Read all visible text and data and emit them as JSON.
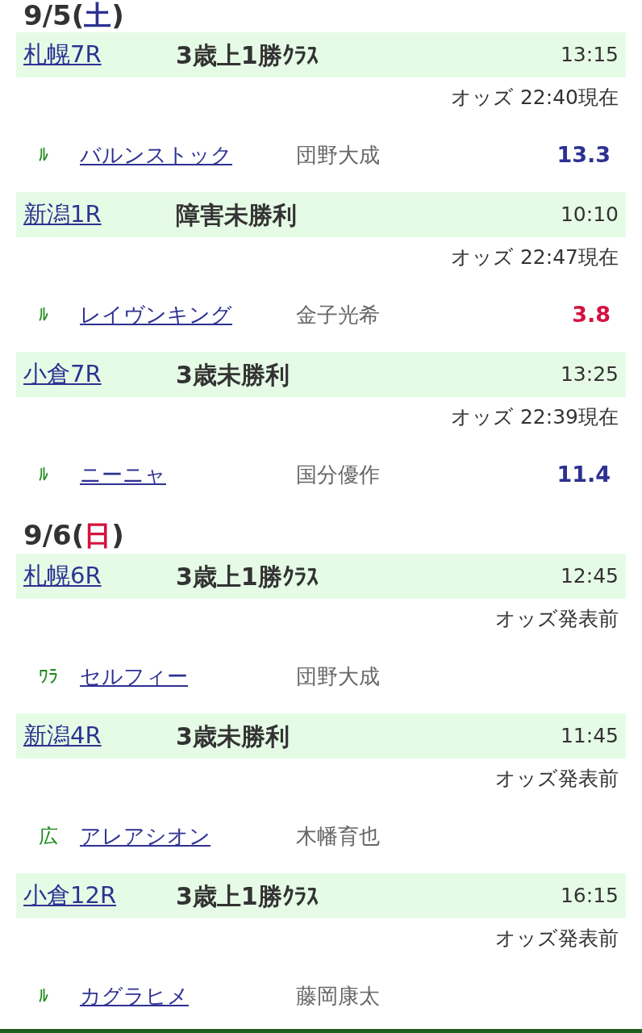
{
  "days": [
    {
      "date_prefix": "9/5(",
      "weekday": "土",
      "date_suffix": ")",
      "color": "#2d3192",
      "races": [
        {
          "venue": "札幌7R",
          "name": "3歳上1勝ｸﾗｽ",
          "time": "13:15",
          "odds_status": "オッズ 22:40現在",
          "horses": [
            {
              "mark": "ﾙ",
              "name": "バルンストック",
              "jockey": "団野大成",
              "odds": "13.3",
              "color": "#2d3192"
            }
          ]
        },
        {
          "venue": "新潟1R",
          "name": "障害未勝利",
          "time": "10:10",
          "odds_status": "オッズ 22:47現在",
          "horses": [
            {
              "mark": "ﾙ",
              "name": "レイヴンキング",
              "jockey": "金子光希",
              "odds": "3.8",
              "color": "#d41240"
            }
          ]
        },
        {
          "venue": "小倉7R",
          "name": "3歳未勝利",
          "time": "13:25",
          "odds_status": "オッズ 22:39現在",
          "horses": [
            {
              "mark": "ﾙ",
              "name": "ニーニャ",
              "jockey": "国分優作",
              "odds": "11.4",
              "color": "#2d3192"
            }
          ]
        }
      ]
    },
    {
      "date_prefix": "9/6(",
      "weekday": "日",
      "date_suffix": ")",
      "color": "#d41240",
      "races": [
        {
          "venue": "札幌6R",
          "name": "3歳上1勝ｸﾗｽ",
          "time": "12:45",
          "odds_status": "オッズ発表前",
          "horses": [
            {
              "mark": "ﾜﾗ",
              "name": "セルフィー",
              "jockey": "団野大成"
            }
          ]
        },
        {
          "venue": "新潟4R",
          "name": "3歳未勝利",
          "time": "11:45",
          "odds_status": "オッズ発表前",
          "horses": [
            {
              "mark": "広",
              "name": "アレアシオン",
              "jockey": "木幡育也"
            }
          ]
        },
        {
          "venue": "小倉12R",
          "name": "3歳上1勝ｸﾗｽ",
          "time": "16:15",
          "odds_status": "オッズ発表前",
          "horses": [
            {
              "mark": "ﾙ",
              "name": "カグラヒメ",
              "jockey": "藤岡康太"
            }
          ]
        }
      ]
    }
  ]
}
